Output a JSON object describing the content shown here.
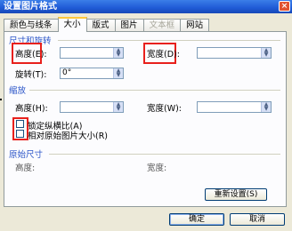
{
  "window": {
    "title": "设置图片格式",
    "close": "×"
  },
  "tabs": [
    {
      "label": "颜色与线条",
      "active": false,
      "disabled": false
    },
    {
      "label": "大小",
      "active": true,
      "disabled": false
    },
    {
      "label": "版式",
      "active": false,
      "disabled": false
    },
    {
      "label": "图片",
      "active": false,
      "disabled": false
    },
    {
      "label": "文本框",
      "active": false,
      "disabled": true
    },
    {
      "label": "网站",
      "active": false,
      "disabled": false
    }
  ],
  "size_section": {
    "title": "尺寸和旋转",
    "height_label": "高度(E):",
    "height_value": "",
    "width_label": "宽度(D):",
    "width_value": "",
    "rotate_label": "旋转(T):",
    "rotate_value": "0°"
  },
  "scale_section": {
    "title": "缩放",
    "height_label": "高度(H):",
    "height_value": "",
    "width_label": "宽度(W):",
    "width_value": "",
    "lock_ratio_label": "锁定纵横比(A)",
    "relative_label": "相对原始图片大小(R)"
  },
  "original_section": {
    "title": "原始尺寸",
    "height_label": "高度:",
    "width_label": "宽度:",
    "reset_label": "重新设置(S)"
  },
  "buttons": {
    "ok": "确定",
    "cancel": "取消"
  },
  "colors": {
    "accent": "#2b55c8",
    "highlight": "#e8201c",
    "tab_marker": "#ffc83c"
  }
}
